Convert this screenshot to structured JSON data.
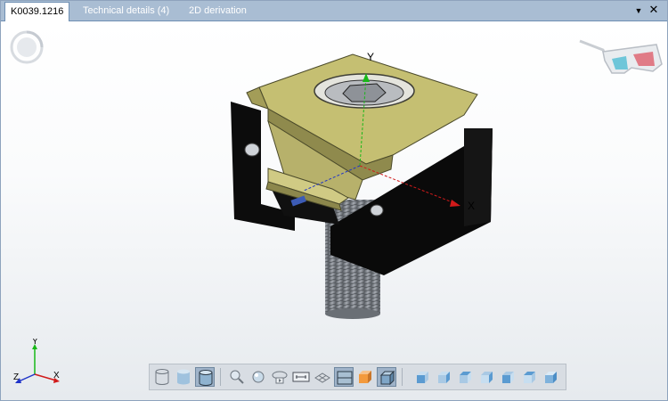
{
  "tabs": [
    {
      "label": "K0039.1216",
      "active": true
    },
    {
      "label": "Technical details (4)",
      "active": false
    },
    {
      "label": "2D derivation",
      "active": false
    }
  ],
  "tab_menu_icon": "triangle-down-icon",
  "tab_close_icon": "close-icon",
  "axes": {
    "x": "X",
    "y": "Y",
    "z": "Z"
  },
  "colors": {
    "part_body": "#c8c27a",
    "block": "#0b0b0b",
    "thread": "#8a9099",
    "tab_active": "#ffffff",
    "tab_bar": "#a9bdd3"
  },
  "toolbar_groups": [
    [
      "wireframe-cylinder-icon",
      "shaded-cylinder-icon",
      "shaded-edges-cylinder-icon"
    ],
    [
      "zoom-icon",
      "zoom-fit-icon",
      "rotate-icon",
      "dimension-icon",
      "grid-icon",
      "section-icon",
      "render-box-icon",
      "transparent-box-icon"
    ],
    [
      "view-iso-1-icon",
      "view-iso-2-icon",
      "view-iso-3-icon",
      "view-iso-4-icon",
      "view-iso-5-icon",
      "view-iso-6-icon",
      "view-iso-7-icon"
    ]
  ]
}
